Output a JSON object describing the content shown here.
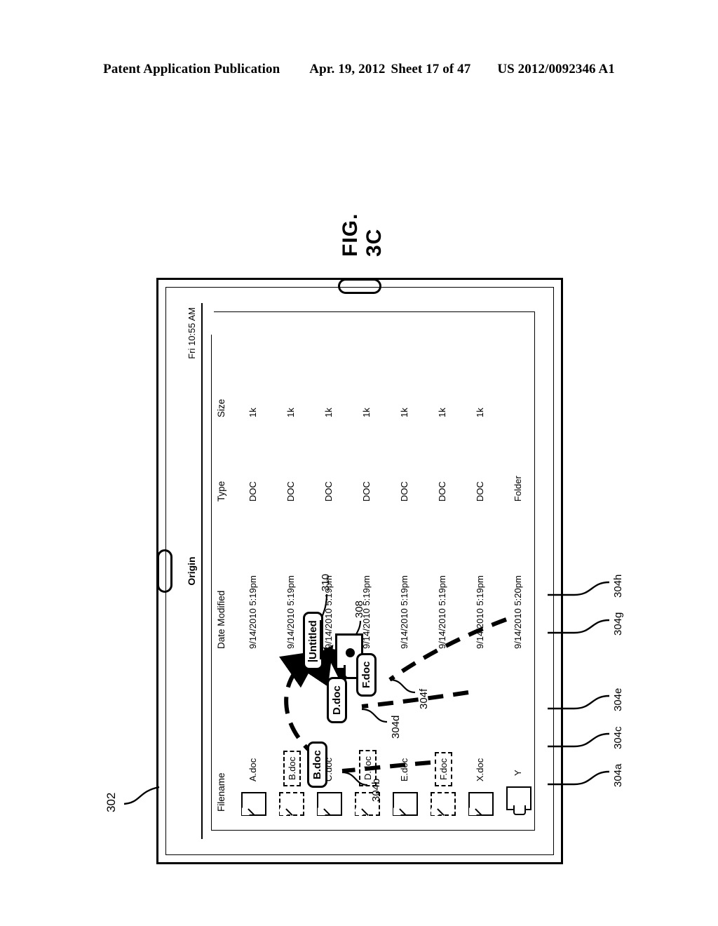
{
  "patent_header": {
    "publication": "Patent Application Publication",
    "date": "Apr. 19, 2012",
    "sheet": "Sheet 17 of 47",
    "number": "US 2012/0092346 A1"
  },
  "figure": {
    "caption": "FIG. 3C",
    "device_ref": "302",
    "drop_target_ref": "308",
    "drop_label_ref": "310",
    "drag_refs": [
      "304b",
      "304d",
      "304f"
    ]
  },
  "device": {
    "title_bar": {
      "title": "Origin",
      "clock": "Fri 10:55 AM"
    },
    "file_window": {
      "columns": [
        "Filename",
        "Date Modified",
        "Type",
        "Size"
      ],
      "rows": [
        {
          "ref": "304a",
          "icon": "document-icon",
          "name": "A.doc",
          "selected": false,
          "date": "9/14/2010 5:19pm",
          "type": "DOC",
          "size": "1k"
        },
        {
          "ref": "304b",
          "icon": "document-icon-dashed",
          "name": "B.doc",
          "selected": true,
          "date": "9/14/2010 5:19pm",
          "type": "DOC",
          "size": "1k"
        },
        {
          "ref": "304c",
          "icon": "document-icon",
          "name": "C.doc",
          "selected": false,
          "date": "9/14/2010 5:19pm",
          "type": "DOC",
          "size": "1k"
        },
        {
          "ref": "304d",
          "icon": "document-icon-dashed",
          "name": "D.doc",
          "selected": true,
          "date": "9/14/2010 5:19pm",
          "type": "DOC",
          "size": "1k"
        },
        {
          "ref": "304e",
          "icon": "document-icon",
          "name": "E.doc",
          "selected": false,
          "date": "9/14/2010 5:19pm",
          "type": "DOC",
          "size": "1k"
        },
        {
          "ref": "304f",
          "icon": "document-icon-dashed",
          "name": "F.doc",
          "selected": true,
          "date": "9/14/2010 5:19pm",
          "type": "DOC",
          "size": "1k"
        },
        {
          "ref": "304g",
          "icon": "document-icon",
          "name": "X.doc",
          "selected": false,
          "date": "9/14/2010 5:19pm",
          "type": "DOC",
          "size": "1k"
        },
        {
          "ref": "304h",
          "icon": "folder-icon",
          "name": "Y",
          "selected": false,
          "date": "9/14/2010 5:20pm",
          "type": "Folder",
          "size": ""
        }
      ]
    },
    "drag_chips": [
      {
        "label": "B.doc",
        "ref": "304b"
      },
      {
        "label": "D.doc",
        "ref": "304d"
      },
      {
        "label": "F.doc",
        "ref": "304f"
      }
    ],
    "drop_target": {
      "icon": "folder-icon",
      "ref": "308",
      "label": "Untitled",
      "label_ref": "310"
    }
  }
}
